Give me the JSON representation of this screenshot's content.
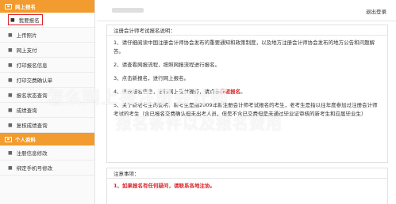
{
  "sidebar": {
    "section1_title": "网上报名",
    "items1": [
      {
        "label": "我要报名",
        "active": true
      },
      {
        "label": "上传照片"
      },
      {
        "label": "网上支付"
      },
      {
        "label": "打印报名信息"
      },
      {
        "label": "打印交费确认单"
      },
      {
        "label": "报名状态查询"
      },
      {
        "label": "成绩查询"
      },
      {
        "label": "复核成绩查询"
      }
    ],
    "section2_title": "个人资料",
    "items2": [
      {
        "label": "注册信息修改"
      },
      {
        "label": "绑定手机号修改"
      }
    ]
  },
  "header": {
    "logout": "退出登录"
  },
  "panel1": {
    "title": "注册会计师考试报名说明：",
    "p1": "1、请仔细阅读中国注册会计师协会发布的重要通知和政策制度，以及地方注册会计师协会发布的地方公告和问题解答。",
    "p2": "2、请查看网报流程，按照网报流程进行报名。",
    "p3": "3、点击新报名，进行网上报名。",
    "p4_prefix": "4、修改报名信息，进行网上支付操作，请点击",
    "p4_link": "我要报名",
    "p4_suffix": "。",
    "p5": "5、关于新老考生的说明：新考生是指2009年新注册会计师考试报名的考生，老考生是指以往年度参加过注册会计师考试的考生（含已报名交费确认但未出考人员，但是不含已交费但是未通过毕业证审核的新考生和应届毕业生）"
  },
  "panel2": {
    "title": "注意事项：",
    "note": "1、如果报名有任何疑问，请联系各地注协。"
  },
  "watermark": {
    "line1": "怎么网上报注册会计师",
    "line2": "报名条件以及报名费用"
  },
  "colors": {
    "accent": "#f29b2e",
    "alert": "#d9262c"
  }
}
